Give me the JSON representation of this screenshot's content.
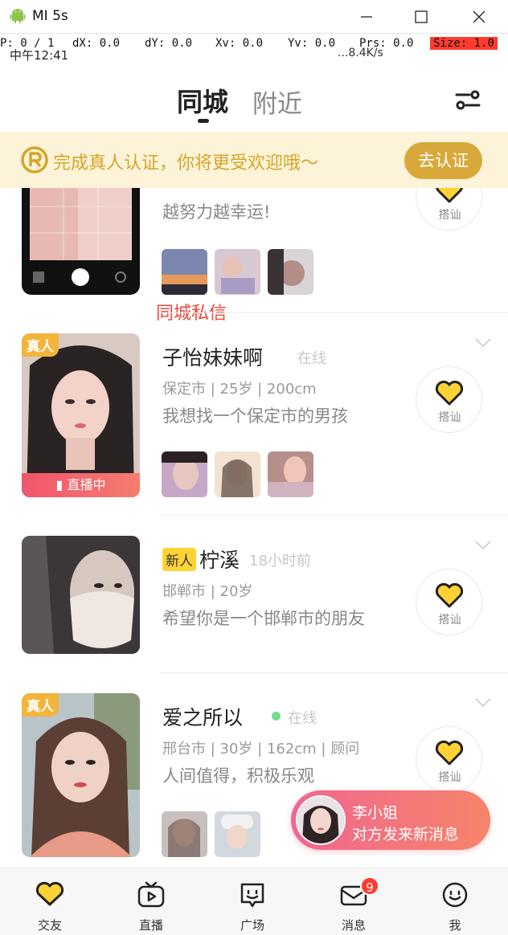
{
  "window": {
    "title": "MI 5s"
  },
  "debug": {
    "p": "P: 0 / 1",
    "dx": "dX: 0.0",
    "dy": "dY: 0.0",
    "xv": "Xv: 0.0",
    "yv": "Yv: 0.0",
    "prs": "Prs: 0.0",
    "size": "Size: 1.0"
  },
  "status": {
    "time": "中午12:41",
    "speed": "...8.4K/s"
  },
  "tabs": {
    "city": "同城",
    "nearby": "附近"
  },
  "banner": {
    "text": "完成真人认证，你将更受欢迎哦～",
    "button": "去认证"
  },
  "users": [
    {
      "sign": "越努力越幸运!",
      "hello": "搭讪",
      "red_link": "同城私信"
    },
    {
      "name": "子怡妹妹啊",
      "status": "在线",
      "meta": "保定市 | 25岁 | 200cm",
      "sign": "我想找一个保定市的男孩",
      "badge": "真人",
      "live": "直播中",
      "hello": "搭讪"
    },
    {
      "new_badge": "新人",
      "name": "柠溪",
      "status": "18小时前",
      "meta": "邯郸市 | 20岁",
      "sign": "希望你是一个邯郸市的朋友",
      "hello": "搭讪"
    },
    {
      "name": "爱之所以",
      "status": "在线",
      "meta": "邢台市 | 30岁 | 162cm | 顾问",
      "sign": "人间值得，积极乐观",
      "badge": "真人",
      "hello": "搭讪"
    }
  ],
  "toast": {
    "name": "李小姐",
    "message": "对方发来新消息"
  },
  "nav": [
    {
      "label": "交友",
      "icon": "heart-icon"
    },
    {
      "label": "直播",
      "icon": "tv-icon"
    },
    {
      "label": "广场",
      "icon": "square-face-icon"
    },
    {
      "label": "消息",
      "icon": "mail-icon",
      "badge": "9"
    },
    {
      "label": "我",
      "icon": "smile-icon"
    }
  ],
  "colors": {
    "accent": "#f3b43a",
    "banner_bg": "#fdf3d8",
    "toast_start": "#f06690",
    "toast_end": "#f6846a",
    "badge_red": "#ff3b30"
  }
}
